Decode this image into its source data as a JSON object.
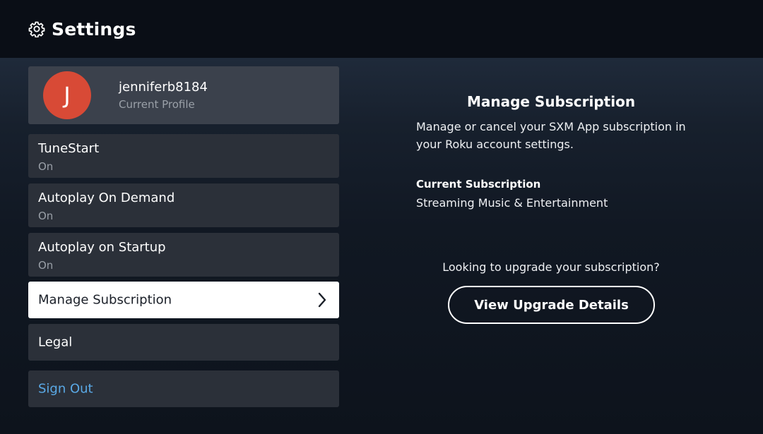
{
  "header": {
    "title": "Settings",
    "icon": "gear-icon"
  },
  "profile": {
    "initial": "J",
    "name": "jenniferb8184",
    "subtitle": "Current Profile",
    "avatar_color": "#d84a36"
  },
  "menu": {
    "tunestart": {
      "label": "TuneStart",
      "value": "On"
    },
    "autoplay_on_demand": {
      "label": "Autoplay On Demand",
      "value": "On"
    },
    "autoplay_on_startup": {
      "label": "Autoplay on Startup",
      "value": "On"
    },
    "manage_subscription": {
      "label": "Manage Subscription",
      "icon": "chevron-right-icon"
    },
    "legal": {
      "label": "Legal"
    },
    "sign_out": {
      "label": "Sign Out",
      "color": "#5aa9e6"
    }
  },
  "detail": {
    "title": "Manage Subscription",
    "description": "Manage or cancel your SXM App subscription in your Roku account settings.",
    "current_label": "Current Subscription",
    "current_value": "Streaming Music & Entertainment",
    "upgrade_question": "Looking to upgrade your subscription?",
    "upgrade_button": "View Upgrade Details"
  }
}
